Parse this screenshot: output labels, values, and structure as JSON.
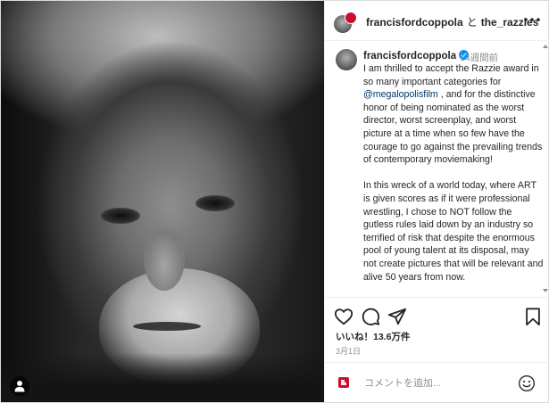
{
  "photo": {
    "alt_icon": "person-tag-icon"
  },
  "header": {
    "user1": "francisfordcoppola",
    "separator": "と",
    "user2": "the_razzies"
  },
  "caption": {
    "username": "francisfordcoppola",
    "verified": true,
    "time": "14週間前",
    "p1_before": "I am thrilled to accept the Razzie award in so many important categories for ",
    "mention": "@megalopolisfilm",
    "p1_after": " , and for the distinctive honor of being nominated as the worst director, worst screenplay, and worst picture at a time when so few have the courage to go against the prevailing trends of contemporary moviemaking!",
    "p2": "In this wreck of a world today, where ART is given scores as if it were professional wrestling, I chose to NOT follow the gutless rules laid down by an industry so terrified of risk that despite the enormous pool of young talent at its disposal, may not create pictures that will be relevant and alive 50 years from now."
  },
  "actions": {
    "like_icon": "heart-icon",
    "comment_icon": "comment-icon",
    "share_icon": "share-icon",
    "save_icon": "bookmark-icon",
    "likes": "いいね！13.6万件",
    "date": "3月1日"
  },
  "comment_box": {
    "placeholder": "コメントを追加...",
    "emoji_icon": "emoji-icon"
  },
  "colors": {
    "link": "#00376b",
    "verified": "#0095f6",
    "muted": "#8e8e8e",
    "razzie_red": "#c8102e"
  }
}
